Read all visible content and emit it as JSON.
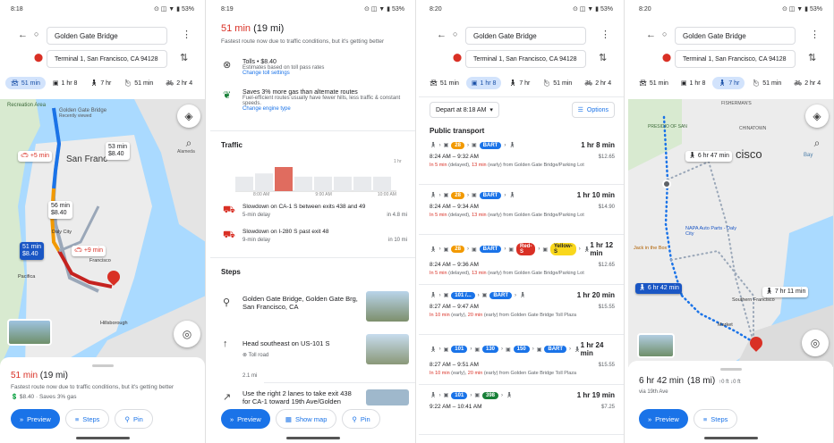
{
  "screens": [
    {
      "time": "8:18",
      "battery": "53%",
      "origin": "Golden Gate Bridge",
      "destination": "Terminal 1, San Francisco, CA 94128",
      "modes": [
        {
          "label": "51 min",
          "icon": "car-icon"
        },
        {
          "label": "1 hr 8",
          "icon": "transit-icon"
        },
        {
          "label": "7 hr",
          "icon": "walk-icon"
        },
        {
          "label": "51 min",
          "icon": "hail-icon"
        },
        {
          "label": "2 hr 4",
          "icon": "bike-icon"
        }
      ],
      "map": {
        "labels": {
          "recreation": "Recreation Area",
          "ggb": "Golden Gate Bridge",
          "ggb_sub": "Recently viewed",
          "sf": "San Franc",
          "sausalito": "Alameda",
          "daly": "Daly City",
          "pacifica": "Pacifica",
          "sfo": "Francisco",
          "hillsborough": "Hillsborough"
        },
        "bubbles": [
          {
            "t": "53 min",
            "s": "$8.40"
          },
          {
            "t": "56 min",
            "s": "$8.40"
          },
          {
            "t": "51 min",
            "s": "$8.40"
          }
        ],
        "delays": [
          "+5 min",
          "+9 min"
        ]
      },
      "title": "51 min",
      "distance": "(19 mi)",
      "desc": "Fastest route now due to traffic conditions, but it's getting better",
      "info": "$8.40 · Saves 3% gas",
      "buttons": {
        "preview": "Preview",
        "steps": "Steps",
        "pin": "Pin"
      }
    },
    {
      "time": "8:19",
      "battery": "53%",
      "title": "51 min",
      "distance": "(19 mi)",
      "desc": "Fastest route now due to traffic conditions, but it's getting better",
      "tolls": {
        "title": "Tolls • $8.40",
        "sub": "Estimates based on toll pass rates",
        "link": "Change toll settings"
      },
      "gas": {
        "title": "Saves 3% more gas than alternate routes",
        "sub": "Fuel-efficient routes usually have fewer hills, less traffic & constant speeds.",
        "link": "Change engine type"
      },
      "traffic_heading": "Traffic",
      "traffic_chart": {
        "bars": [
          0.45,
          0.55,
          0.75,
          0.45,
          0.45,
          0.45,
          0.45,
          0.45
        ],
        "ticks": [
          "8:00 AM",
          "9:00 AM",
          "10:00 AM"
        ],
        "hr": "1 hr"
      },
      "alerts": [
        {
          "t": "Slowdown on CA-1 S between exits 438 and 49",
          "s": "5-min delay",
          "d": "in 4.8 mi"
        },
        {
          "t": "Slowdown on I-280 S past exit 48",
          "s": "9-min delay",
          "d": "in 10 mi"
        }
      ],
      "steps_heading": "Steps",
      "steps": [
        {
          "t": "Golden Gate Bridge, Golden Gate Brg, San Francisco, CA",
          "sub": ""
        },
        {
          "t": "Head southeast on US-101 S",
          "sub": "Toll road"
        },
        {
          "t": "Use the right 2 lanes to take exit 438 for CA-1 toward 19th Ave/Golden",
          "sub": ""
        }
      ],
      "step_dist": "2.1 mi",
      "buttons": {
        "preview": "Preview",
        "showmap": "Show map",
        "pin": "Pin"
      }
    },
    {
      "time": "8:20",
      "battery": "53%",
      "origin": "Golden Gate Bridge",
      "destination": "Terminal 1, San Francisco, CA 94128",
      "modes": [
        {
          "label": "51 min",
          "icon": "car-icon"
        },
        {
          "label": "1 hr 8",
          "icon": "transit-icon"
        },
        {
          "label": "7 hr",
          "icon": "walk-icon"
        },
        {
          "label": "51 min",
          "icon": "hail-icon"
        },
        {
          "label": "2 hr 4",
          "icon": "bike-icon"
        }
      ],
      "depart": "Depart at 8:18 AM",
      "options": "Options",
      "section": "Public transport",
      "routes": [
        {
          "lines": [
            "28",
            "BART"
          ],
          "dur": "1 hr 8 min",
          "times": "8:24 AM – 9:32 AM",
          "fare": "$12.65",
          "d1": "In 5 min",
          "d2": " (delayed), ",
          "d3": "13 min",
          "d4": " (early) from Golden Gate Bridge/Parking Lot"
        },
        {
          "lines": [
            "28",
            "BART"
          ],
          "dur": "1 hr 10 min",
          "times": "8:24 AM – 9:34 AM",
          "fare": "$14.90",
          "d1": "In 5 min",
          "d2": " (delayed), ",
          "d3": "13 min",
          "d4": " (early) from Golden Gate Bridge/Parking Lot"
        },
        {
          "lines": [
            "28",
            "BART",
            "Red-S",
            "Yellow-S"
          ],
          "dur": "1 hr 12 min",
          "times": "8:24 AM – 9:36 AM",
          "fare": "$12.65",
          "d1": "In 5 min",
          "d2": " (delayed), ",
          "d3": "13 min",
          "d4": " (early) from Golden Gate Bridge/Parking Lot"
        },
        {
          "lines": [
            "101 /...",
            "BART"
          ],
          "dur": "1 hr 20 min",
          "times": "8:27 AM – 9:47 AM",
          "fare": "$15.55",
          "d1": "In 10 min",
          "d2": " (early), ",
          "d3": "20 min",
          "d4": " (early) from Golden Gate Bridge Toll Plaza"
        },
        {
          "lines": [
            "101",
            "130",
            "150",
            "BART"
          ],
          "dur": "1 hr 24 min",
          "times": "8:27 AM – 9:51 AM",
          "fare": "$15.55",
          "d1": "In 10 min",
          "d2": " (early), ",
          "d3": "20 min",
          "d4": " (early) from Golden Gate Bridge Toll Plaza"
        },
        {
          "lines": [
            "101",
            "398"
          ],
          "dur": "1 hr 19 min",
          "times": "9:22 AM – 10:41 AM",
          "fare": "$7.25",
          "d1": "",
          "d2": "",
          "d3": "",
          "d4": ""
        }
      ]
    },
    {
      "time": "8:20",
      "battery": "53%",
      "origin": "Golden Gate Bridge",
      "destination": "Terminal 1, San Francisco, CA 94128",
      "modes": [
        {
          "label": "51 min",
          "icon": "car-icon"
        },
        {
          "label": "1 hr 8",
          "icon": "transit-icon"
        },
        {
          "label": "7 hr",
          "icon": "walk-icon"
        },
        {
          "label": "51 min",
          "icon": "hail-icon"
        },
        {
          "label": "2 hr 4",
          "icon": "bike-icon"
        }
      ],
      "map": {
        "labels": {
          "fisherman": "FISHERMAN'S",
          "presidio": "PRESIDIO OF SAN",
          "chinatown": "CHINATOWN",
          "cisco": "cisco",
          "bay": "Bay",
          "napa": "NAPA Auto Parts - Daly City",
          "jack": "Jack in the Box",
          "south": "Southern Francisco",
          "market": "Market"
        },
        "bubbles": [
          "6 hr 47 min",
          "6 hr 42 min",
          "7 hr 11 min"
        ]
      },
      "title": "6 hr 42 min",
      "distance": "(18 mi)",
      "elev": "↑0 ft  ↓0 ft",
      "via": "via 19th Ave",
      "buttons": {
        "preview": "Preview",
        "steps": "Steps"
      }
    }
  ]
}
